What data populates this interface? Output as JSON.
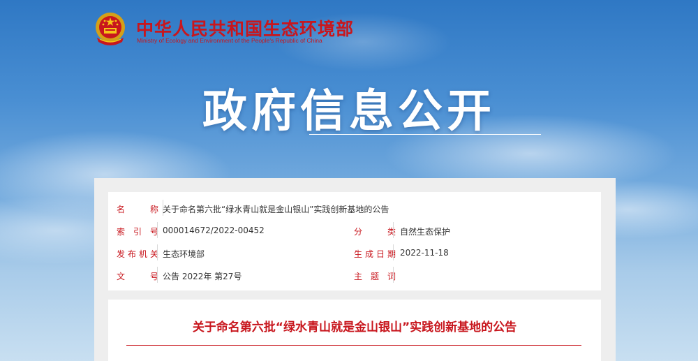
{
  "header": {
    "title": "中华人民共和国生态环境部",
    "subtitle": "Ministry of Ecology and Environment of the People's Republic of China",
    "emblem_icon": "national-emblem-icon"
  },
  "hero": {
    "title": "政府信息公开"
  },
  "meta": {
    "name_label": "名　称",
    "name_value": "关于命名第六批“绿水青山就是金山银山”实践创新基地的公告",
    "index_label": "索引号",
    "index_value": "000014672/2022-00452",
    "category_label": "分　类",
    "category_value": "自然生态保护",
    "publisher_label": "发布机关",
    "publisher_value": "生态环境部",
    "date_label": "生成日期",
    "date_value": "2022-11-18",
    "docno_label": "文　号",
    "docno_value": "公告 2022年 第27号",
    "keywords_label": "主题词",
    "keywords_value": ""
  },
  "article": {
    "title": "关于命名第六批“绿水青山就是金山银山”实践创新基地的公告"
  },
  "colors": {
    "accent": "#c8161d",
    "sky_top": "#2f78c4",
    "panel_bg": "#eeeeee"
  }
}
